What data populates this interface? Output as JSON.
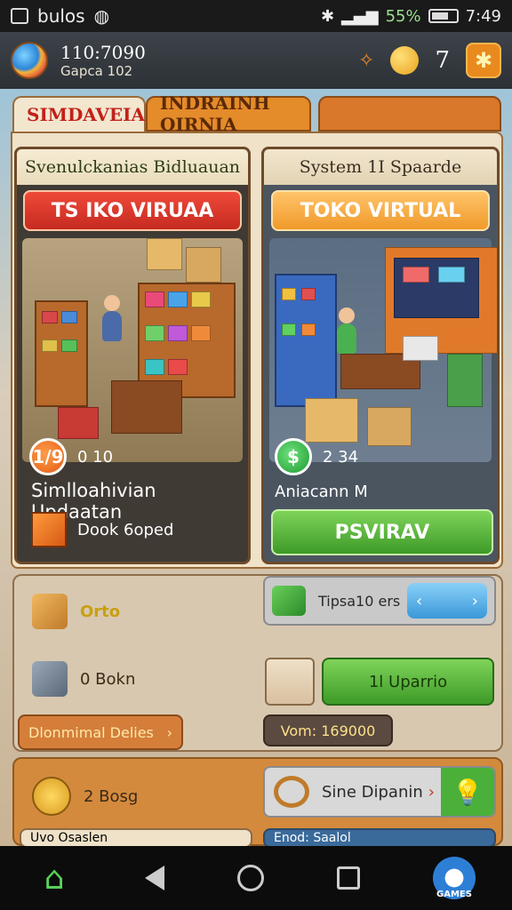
{
  "status_bar": {
    "app": "bulos",
    "battery": "55%",
    "time": "7:49"
  },
  "header": {
    "player_name": "110:7090",
    "player_sub": "Gapca 102",
    "level": "7"
  },
  "tabs": [
    {
      "label": "SIMDAVEIA",
      "active": true
    },
    {
      "label": "INDRAINH OIRNIA",
      "active": false
    },
    {
      "label": "",
      "active": false
    }
  ],
  "cards": {
    "left": {
      "header": "Svenulckanias Bidluauan",
      "button": "TS IKO VIRUAA",
      "coin_value": "1/9",
      "stat": "0 10",
      "title": "Simlloahivian Updaatan",
      "item_label": "Dook 6oped"
    },
    "right": {
      "header": "System 1I Spaarde",
      "button": "TOKO VIRTUAL",
      "coin_value": "$",
      "stat": "2 34",
      "title": "Aniacann M",
      "action": "PSVIRAV"
    }
  },
  "middle_panel": {
    "item1": "Orto",
    "item2": "0 Bokn",
    "item3": "Dlonmimal Delies",
    "pill_top_label": "Tipsa10 ers",
    "upgrade_button": "1l Uparrio",
    "value_label": "Vom: 169000"
  },
  "bottom_panel": {
    "item1": "2 Bosg",
    "action": "Sine Dipanin",
    "sub_left": "Uvo Osaslen",
    "sub_right": "Enod: Saalol"
  },
  "navbar": {
    "games_label": "GAMES"
  },
  "colors": {
    "accent_red": "#c62a20",
    "accent_green": "#3d9a28",
    "accent_orange": "#f09a2a",
    "panel_beige": "#efe2c8"
  }
}
